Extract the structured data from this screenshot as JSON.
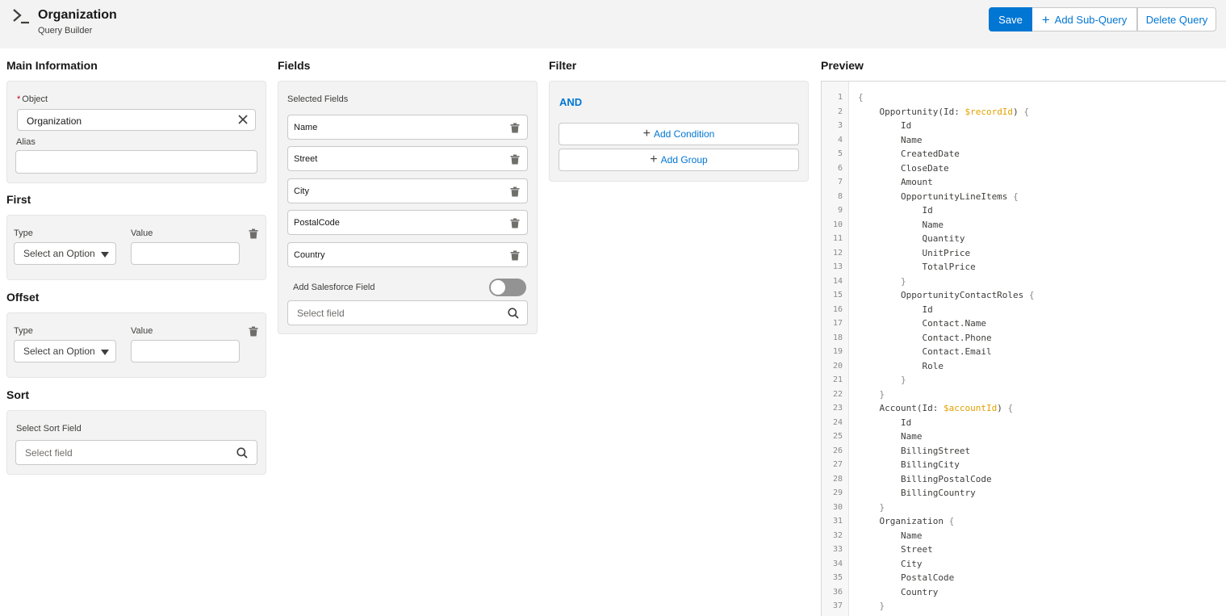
{
  "header": {
    "title": "Organization",
    "subtitle": "Query Builder",
    "buttons": {
      "save": "Save",
      "add_sub_query": "Add Sub-Query",
      "delete_query": "Delete Query"
    }
  },
  "main_information": {
    "title": "Main Information",
    "object_label": "Object",
    "object_required_mark": "*",
    "object_value": "Organization",
    "alias_label": "Alias",
    "alias_value": ""
  },
  "first": {
    "title": "First",
    "type_label": "Type",
    "type_placeholder": "Select an Option",
    "value_label": "Value",
    "value": ""
  },
  "offset": {
    "title": "Offset",
    "type_label": "Type",
    "type_placeholder": "Select an Option",
    "value_label": "Value",
    "value": ""
  },
  "sort": {
    "title": "Sort",
    "label": "Select Sort Field",
    "placeholder": "Select field"
  },
  "fields": {
    "title": "Fields",
    "selected_label": "Selected Fields",
    "items": [
      "Name",
      "Street",
      "City",
      "PostalCode",
      "Country"
    ],
    "add_sf_field_label": "Add Salesforce Field",
    "add_sf_field_enabled": false,
    "select_placeholder": "Select field"
  },
  "filter": {
    "title": "Filter",
    "operator": "AND",
    "add_condition": "Add Condition",
    "add_group": "Add Group"
  },
  "preview": {
    "title": "Preview",
    "lines": [
      "{",
      "    Opportunity(Id: $recordId) {",
      "        Id",
      "        Name",
      "        CreatedDate",
      "        CloseDate",
      "        Amount",
      "        OpportunityLineItems {",
      "            Id",
      "            Name",
      "            Quantity",
      "            UnitPrice",
      "            TotalPrice",
      "        }",
      "        OpportunityContactRoles {",
      "            Id",
      "            Contact.Name",
      "            Contact.Phone",
      "            Contact.Email",
      "            Role",
      "        }",
      "    }",
      "    Account(Id: $accountId) {",
      "        Id",
      "        Name",
      "        BillingStreet",
      "        BillingCity",
      "        BillingPostalCode",
      "        BillingCountry",
      "    }",
      "    Organization {",
      "        Name",
      "        Street",
      "        City",
      "        PostalCode",
      "        Country",
      "    }"
    ]
  }
}
